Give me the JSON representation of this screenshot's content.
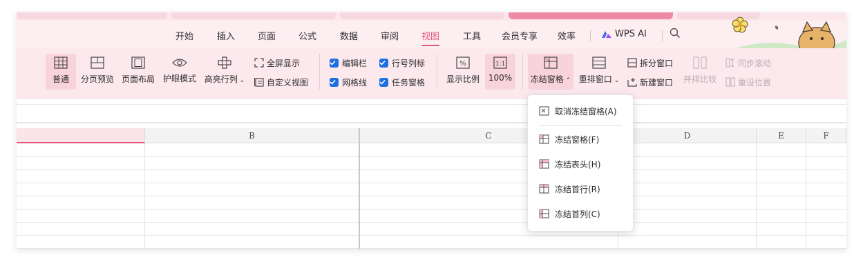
{
  "colors": {
    "accent": "#e2557d",
    "ribbon_bg": "#fce9ee",
    "menu_bg": "#fdeef2",
    "checkbox": "#1e6fe0"
  },
  "menu": {
    "items": [
      "开始",
      "插入",
      "页面",
      "公式",
      "数据",
      "审阅",
      "视图",
      "工具",
      "会员专享",
      "效率"
    ],
    "active": "视图",
    "ai_label": "WPS AI",
    "search_icon": "search-icon"
  },
  "ribbon": {
    "normal": "普通",
    "page_break_preview": "分页预览",
    "page_layout": "页面布局",
    "eye_mode": "护眼模式",
    "highlight_rowcol": "高亮行列",
    "full_screen": "全屏显示",
    "custom_view": "自定义视图",
    "edit_bar": "编辑栏",
    "gridlines": "网格线",
    "row_col_headers": "行号列标",
    "task_pane": "任务窗格",
    "zoom": "显示比例",
    "zoom_100": "100%",
    "freeze_panes": "冻结窗格",
    "rearrange_windows": "重排窗口",
    "split_window": "拆分窗口",
    "new_window": "新建窗口",
    "side_by_side": "并排比较",
    "sync_scroll": "同步滚动",
    "reset_position": "重设位置"
  },
  "grid": {
    "columns": [
      "B",
      "C",
      "D",
      "E",
      "F"
    ]
  },
  "dropdown": {
    "items": [
      "取消冻结窗格(A)",
      "冻结窗格(F)",
      "冻结表头(H)",
      "冻结首行(R)",
      "冻结首列(C)"
    ]
  }
}
